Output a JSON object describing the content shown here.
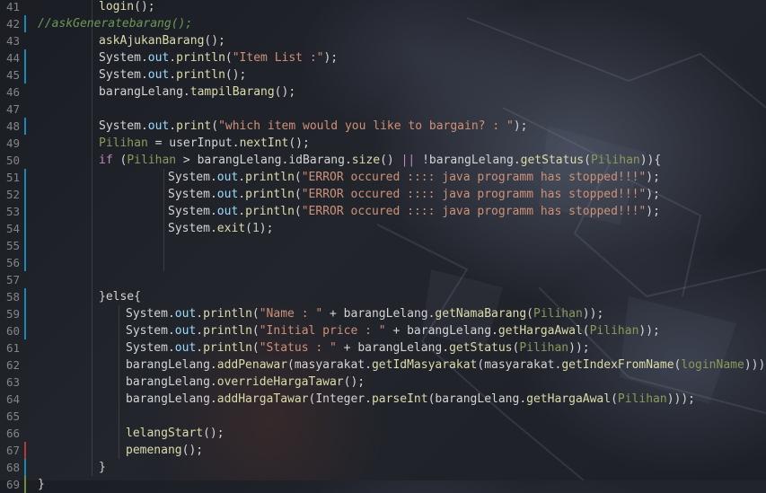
{
  "editor": {
    "lines": [
      {
        "n": "41",
        "mark": "",
        "indent": 1,
        "tokens": [
          [
            "login",
            "fn"
          ],
          [
            "();",
            "punc"
          ]
        ]
      },
      {
        "n": "42",
        "mark": "blue",
        "indent": 0,
        "tokens": [
          [
            "//askGeneratebarang();",
            "cmt"
          ]
        ]
      },
      {
        "n": "43",
        "mark": "",
        "indent": 1,
        "tokens": [
          [
            "askAjukanBarang",
            "fn"
          ],
          [
            "();",
            "punc"
          ]
        ]
      },
      {
        "n": "44",
        "mark": "blue",
        "indent": 1,
        "tokens": [
          [
            "System",
            "id"
          ],
          [
            ".",
            "punc"
          ],
          [
            "out",
            "var"
          ],
          [
            ".",
            "punc"
          ],
          [
            "println",
            "fn"
          ],
          [
            "(",
            "punc"
          ],
          [
            "\"Item List :\"",
            "str"
          ],
          [
            ");",
            "punc"
          ]
        ]
      },
      {
        "n": "45",
        "mark": "blue",
        "indent": 1,
        "tokens": [
          [
            "System",
            "id"
          ],
          [
            ".",
            "punc"
          ],
          [
            "out",
            "var"
          ],
          [
            ".",
            "punc"
          ],
          [
            "println",
            "fn"
          ],
          [
            "();",
            "punc"
          ]
        ]
      },
      {
        "n": "46",
        "mark": "",
        "indent": 1,
        "tokens": [
          [
            "barangLelang",
            "id"
          ],
          [
            ".",
            "punc"
          ],
          [
            "tampilBarang",
            "fn"
          ],
          [
            "();",
            "punc"
          ]
        ]
      },
      {
        "n": "47",
        "mark": "",
        "indent": 0,
        "tokens": []
      },
      {
        "n": "48",
        "mark": "blue",
        "indent": 1,
        "tokens": [
          [
            "System",
            "id"
          ],
          [
            ".",
            "punc"
          ],
          [
            "out",
            "var"
          ],
          [
            ".",
            "punc"
          ],
          [
            "print",
            "fn"
          ],
          [
            "(",
            "punc"
          ],
          [
            "\"which item would you like to bargain? : \"",
            "str"
          ],
          [
            ");",
            "punc"
          ]
        ]
      },
      {
        "n": "49",
        "mark": "",
        "indent": 1,
        "tokens": [
          [
            "Pilihan",
            "param"
          ],
          [
            " = ",
            "op"
          ],
          [
            "userInput",
            "id"
          ],
          [
            ".",
            "punc"
          ],
          [
            "nextInt",
            "fn"
          ],
          [
            "();",
            "punc"
          ]
        ]
      },
      {
        "n": "50",
        "mark": "",
        "indent": 1,
        "tokens": [
          [
            "if",
            "kw"
          ],
          [
            " (",
            "punc"
          ],
          [
            "Pilihan",
            "param"
          ],
          [
            " > ",
            "op"
          ],
          [
            "barangLelang",
            "id"
          ],
          [
            ".",
            "punc"
          ],
          [
            "idBarang",
            "id"
          ],
          [
            ".",
            "punc"
          ],
          [
            "size",
            "fn"
          ],
          [
            "() ",
            "punc"
          ],
          [
            "||",
            "kw"
          ],
          [
            " !",
            "op"
          ],
          [
            "barangLelang",
            "id"
          ],
          [
            ".",
            "punc"
          ],
          [
            "getStatus",
            "fn"
          ],
          [
            "(",
            "punc"
          ],
          [
            "Pilihan",
            "param"
          ],
          [
            ")){",
            "punc"
          ]
        ]
      },
      {
        "n": "51",
        "mark": "blue",
        "indent": 3,
        "tokens": [
          [
            "System",
            "id"
          ],
          [
            ".",
            "punc"
          ],
          [
            "out",
            "var"
          ],
          [
            ".",
            "punc"
          ],
          [
            "println",
            "fn"
          ],
          [
            "(",
            "punc"
          ],
          [
            "\"ERROR occured :::: java programm has stopped!!!\"",
            "str"
          ],
          [
            ");",
            "punc"
          ]
        ]
      },
      {
        "n": "52",
        "mark": "blue",
        "indent": 3,
        "tokens": [
          [
            "System",
            "id"
          ],
          [
            ".",
            "punc"
          ],
          [
            "out",
            "var"
          ],
          [
            ".",
            "punc"
          ],
          [
            "println",
            "fn"
          ],
          [
            "(",
            "punc"
          ],
          [
            "\"ERROR occured :::: java programm has stopped!!!\"",
            "str"
          ],
          [
            ");",
            "punc"
          ]
        ]
      },
      {
        "n": "53",
        "mark": "blue",
        "indent": 3,
        "tokens": [
          [
            "System",
            "id"
          ],
          [
            ".",
            "punc"
          ],
          [
            "out",
            "var"
          ],
          [
            ".",
            "punc"
          ],
          [
            "println",
            "fn"
          ],
          [
            "(",
            "punc"
          ],
          [
            "\"ERROR occured :::: java programm has stopped!!!\"",
            "str"
          ],
          [
            ");",
            "punc"
          ]
        ]
      },
      {
        "n": "54",
        "mark": "blue",
        "indent": 3,
        "tokens": [
          [
            "System",
            "id"
          ],
          [
            ".",
            "punc"
          ],
          [
            "exit",
            "fn"
          ],
          [
            "(",
            "punc"
          ],
          [
            "1",
            "num"
          ],
          [
            ");",
            "punc"
          ]
        ]
      },
      {
        "n": "55",
        "mark": "blue",
        "indent": 0,
        "tokens": []
      },
      {
        "n": "56",
        "mark": "blue",
        "indent": 0,
        "tokens": []
      },
      {
        "n": "57",
        "mark": "",
        "indent": 0,
        "tokens": []
      },
      {
        "n": "58",
        "mark": "blue",
        "indent": 1,
        "tokens": [
          [
            "}else{",
            "punc"
          ]
        ]
      },
      {
        "n": "59",
        "mark": "blue",
        "indent": 2,
        "tokens": [
          [
            "System",
            "id"
          ],
          [
            ".",
            "punc"
          ],
          [
            "out",
            "var"
          ],
          [
            ".",
            "punc"
          ],
          [
            "println",
            "fn"
          ],
          [
            "(",
            "punc"
          ],
          [
            "\"Name : \"",
            "str"
          ],
          [
            " + ",
            "op"
          ],
          [
            "barangLelang",
            "id"
          ],
          [
            ".",
            "punc"
          ],
          [
            "getNamaBarang",
            "fn"
          ],
          [
            "(",
            "punc"
          ],
          [
            "Pilihan",
            "param"
          ],
          [
            "));",
            "punc"
          ]
        ]
      },
      {
        "n": "60",
        "mark": "blue",
        "indent": 2,
        "tokens": [
          [
            "System",
            "id"
          ],
          [
            ".",
            "punc"
          ],
          [
            "out",
            "var"
          ],
          [
            ".",
            "punc"
          ],
          [
            "println",
            "fn"
          ],
          [
            "(",
            "punc"
          ],
          [
            "\"Initial price : \"",
            "str"
          ],
          [
            " + ",
            "op"
          ],
          [
            "barangLelang",
            "id"
          ],
          [
            ".",
            "punc"
          ],
          [
            "getHargaAwal",
            "fn"
          ],
          [
            "(",
            "punc"
          ],
          [
            "Pilihan",
            "param"
          ],
          [
            "));",
            "punc"
          ]
        ]
      },
      {
        "n": "61",
        "mark": "",
        "indent": 2,
        "tokens": [
          [
            "System",
            "id"
          ],
          [
            ".",
            "punc"
          ],
          [
            "out",
            "var"
          ],
          [
            ".",
            "punc"
          ],
          [
            "println",
            "fn"
          ],
          [
            "(",
            "punc"
          ],
          [
            "\"Status : \"",
            "str"
          ],
          [
            " + ",
            "op"
          ],
          [
            "barangLelang",
            "id"
          ],
          [
            ".",
            "punc"
          ],
          [
            "getStatus",
            "fn"
          ],
          [
            "(",
            "punc"
          ],
          [
            "Pilihan",
            "param"
          ],
          [
            "));",
            "punc"
          ]
        ]
      },
      {
        "n": "62",
        "mark": "",
        "indent": 2,
        "tokens": [
          [
            "barangLelang",
            "id"
          ],
          [
            ".",
            "punc"
          ],
          [
            "addPenawar",
            "fn"
          ],
          [
            "(",
            "punc"
          ],
          [
            "masyarakat",
            "id"
          ],
          [
            ".",
            "punc"
          ],
          [
            "getIdMasyarakat",
            "fn"
          ],
          [
            "(",
            "punc"
          ],
          [
            "masyarakat",
            "id"
          ],
          [
            ".",
            "punc"
          ],
          [
            "getIndexFromName",
            "fn"
          ],
          [
            "(",
            "punc"
          ],
          [
            "loginName",
            "param"
          ],
          [
            ")));",
            "punc"
          ]
        ]
      },
      {
        "n": "63",
        "mark": "",
        "indent": 2,
        "tokens": [
          [
            "barangLelang",
            "id"
          ],
          [
            ".",
            "punc"
          ],
          [
            "overrideHargaTawar",
            "fn"
          ],
          [
            "();",
            "punc"
          ]
        ]
      },
      {
        "n": "64",
        "mark": "",
        "indent": 2,
        "tokens": [
          [
            "barangLelang",
            "id"
          ],
          [
            ".",
            "punc"
          ],
          [
            "addHargaTawar",
            "fn"
          ],
          [
            "(",
            "punc"
          ],
          [
            "Integer",
            "id"
          ],
          [
            ".",
            "punc"
          ],
          [
            "parseInt",
            "fn"
          ],
          [
            "(",
            "punc"
          ],
          [
            "barangLelang",
            "id"
          ],
          [
            ".",
            "punc"
          ],
          [
            "getHargaAwal",
            "fn"
          ],
          [
            "(",
            "punc"
          ],
          [
            "Pilihan",
            "param"
          ],
          [
            ")));",
            "punc"
          ]
        ]
      },
      {
        "n": "65",
        "mark": "",
        "indent": 0,
        "tokens": []
      },
      {
        "n": "66",
        "mark": "",
        "indent": 2,
        "tokens": [
          [
            "lelangStart",
            "fn"
          ],
          [
            "();",
            "punc"
          ]
        ]
      },
      {
        "n": "67",
        "mark": "red",
        "indent": 2,
        "tokens": [
          [
            "pemenang",
            "fn"
          ],
          [
            "();",
            "punc"
          ]
        ]
      },
      {
        "n": "68",
        "mark": "blue",
        "indent": 1,
        "tokens": [
          [
            "}",
            "punc"
          ]
        ]
      },
      {
        "n": "69",
        "mark": "green",
        "indent": 0,
        "tokens": [
          [
            "}",
            "punc"
          ]
        ]
      }
    ]
  }
}
